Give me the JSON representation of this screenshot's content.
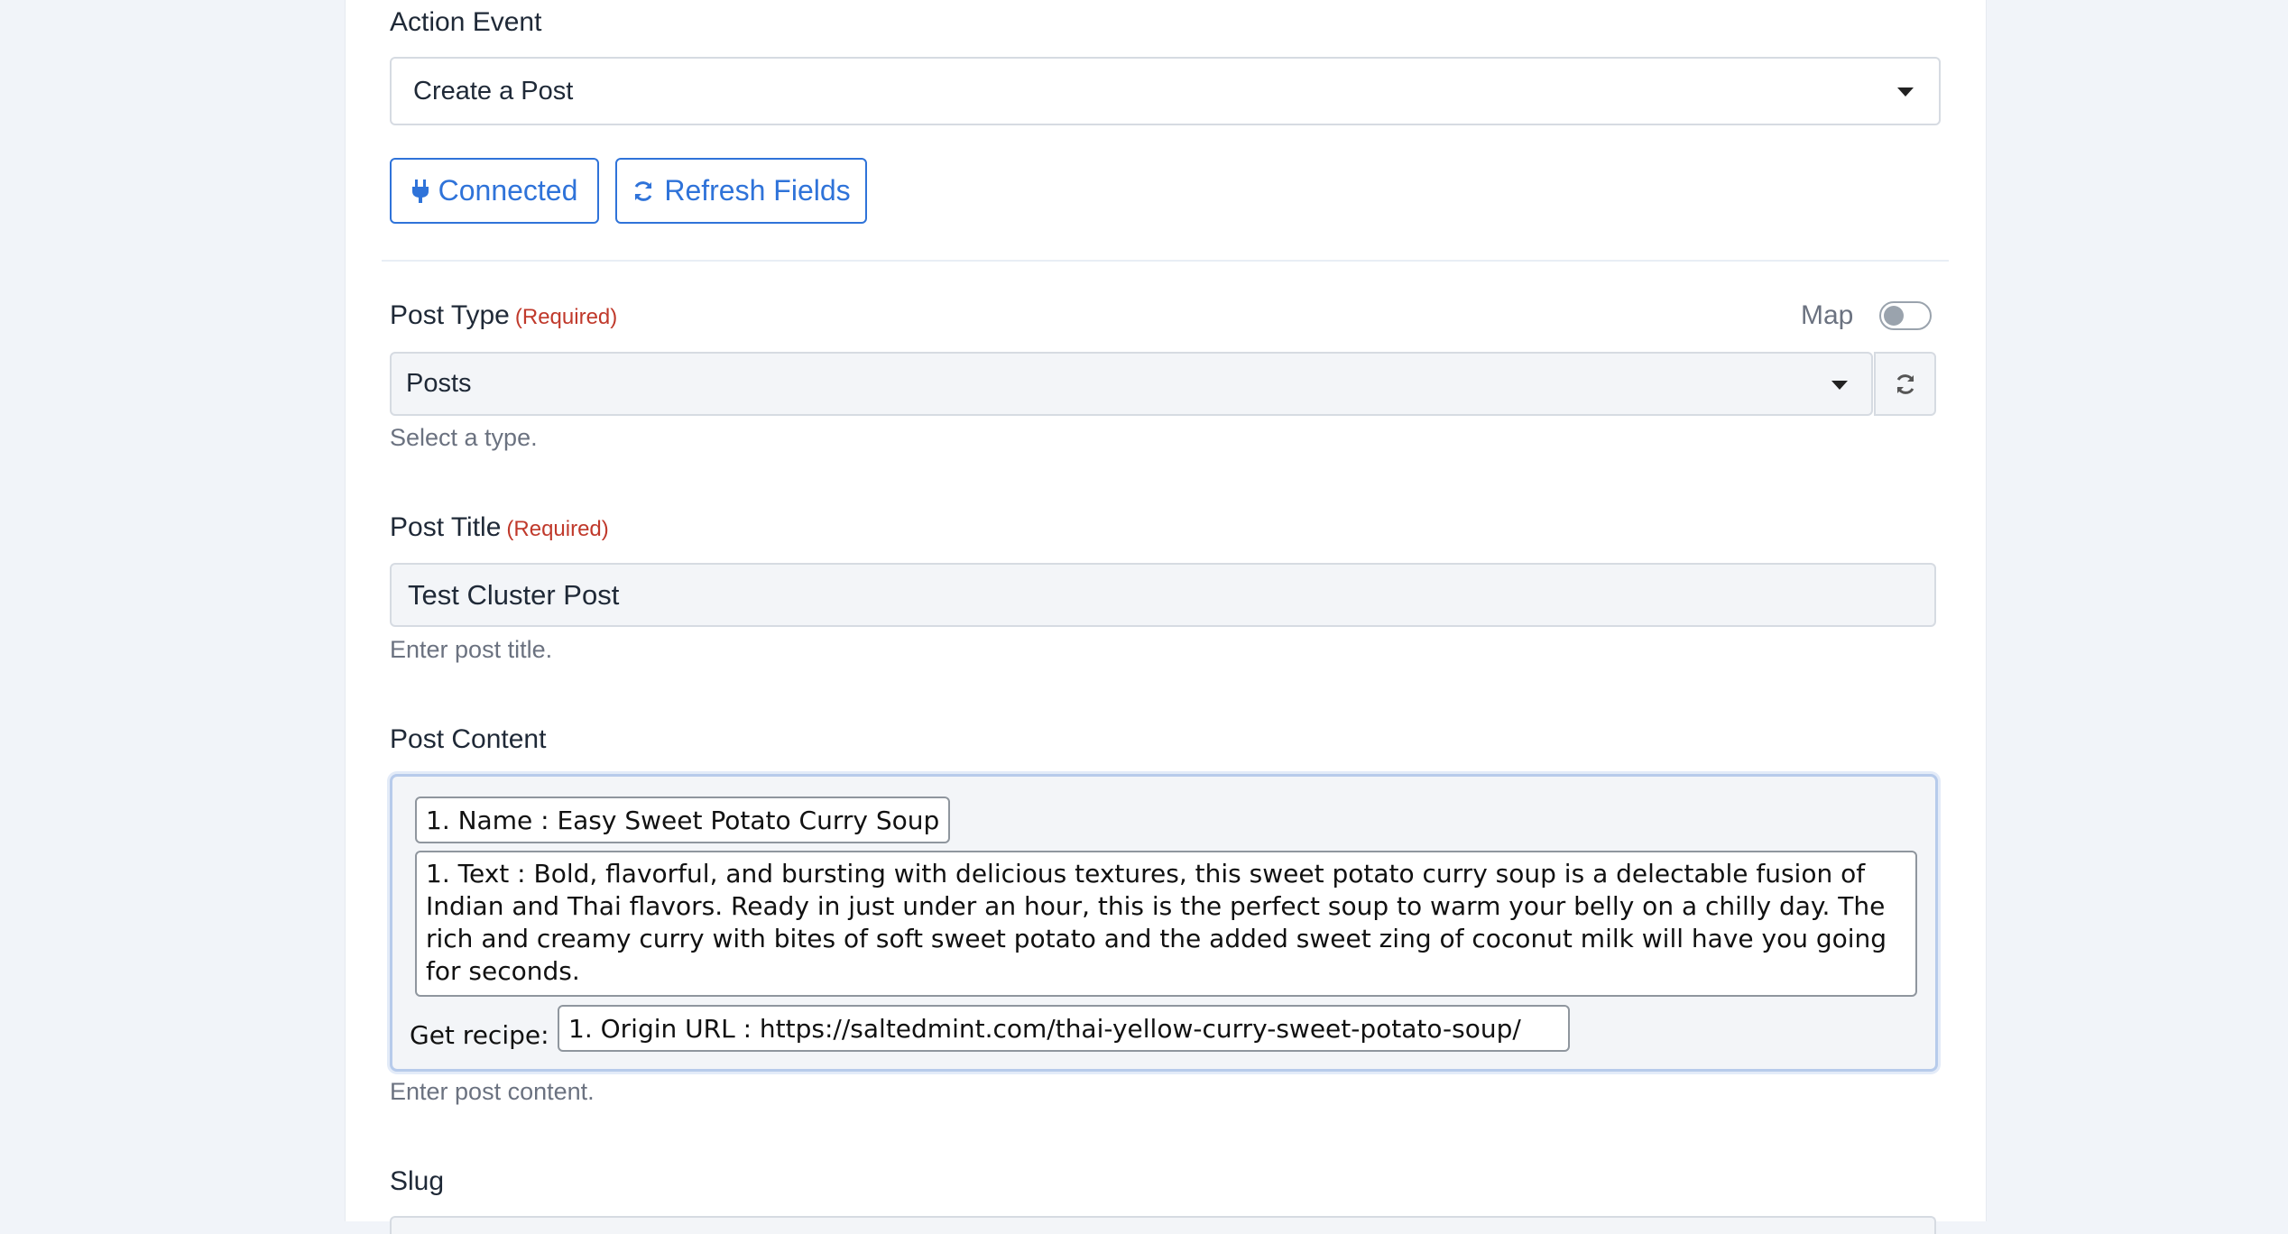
{
  "action_event": {
    "label": "Action Event",
    "selected": "Create a Post"
  },
  "buttons": {
    "connected": "Connected",
    "refresh_fields": "Refresh Fields"
  },
  "post_type": {
    "label": "Post Type",
    "required": "(Required)",
    "map_label": "Map",
    "map_enabled": false,
    "selected": "Posts",
    "help": "Select a type."
  },
  "post_title": {
    "label": "Post Title",
    "required": "(Required)",
    "value": "Test Cluster Post",
    "help": "Enter post title."
  },
  "post_content": {
    "label": "Post Content",
    "name_token": "1. Name : Easy Sweet Potato Curry Soup",
    "text_token": "1. Text : Bold, flavorful, and bursting with delicious textures, this sweet potato curry soup is a delectable fusion of Indian and Thai flavors. Ready in just under an hour, this is the perfect soup to warm your belly on a chilly day. The rich and creamy curry with bites of soft sweet potato and the added sweet zing of coconut milk will have you going for seconds.",
    "recipe_prefix": "Get recipe:",
    "url_token": "1. Origin URL : https://saltedmint.com/thai-yellow-curry-sweet-potato-soup/",
    "help": "Enter post content."
  },
  "slug": {
    "label": "Slug"
  },
  "colors": {
    "accent": "#2f73d9",
    "required": "#c0392b",
    "page_bg": "#f1f4f9"
  },
  "icons": {
    "connected": "plug-icon",
    "refresh": "refresh-icon",
    "dropdown": "caret-down-icon"
  }
}
